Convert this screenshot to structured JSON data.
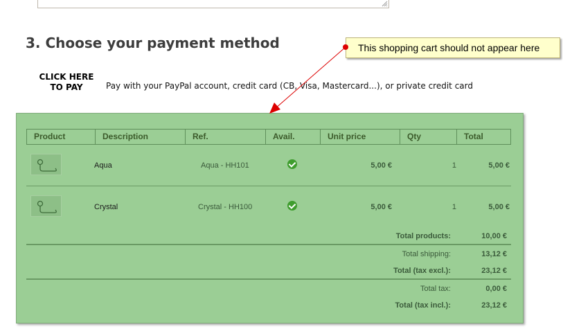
{
  "heading": "3. Choose your payment method",
  "payment": {
    "click_label": "CLICK HERE TO PAY",
    "description": "Pay with your PayPal account, credit card (CB, Visa, Mastercard...), or private credit card"
  },
  "annotation": {
    "text": "This shopping cart should not appear here",
    "color": "#dd0000"
  },
  "cart": {
    "columns": [
      "Product",
      "Description",
      "Ref.",
      "Avail.",
      "Unit price",
      "Qty",
      "Total"
    ],
    "rows": [
      {
        "description": "Aqua",
        "ref": "Aqua - HH101",
        "avail_icon": "check-circle-icon",
        "unit_price": "5,00 €",
        "qty": "1",
        "total": "5,00 €"
      },
      {
        "description": "Crystal",
        "ref": "Crystal - HH100",
        "avail_icon": "check-circle-icon",
        "unit_price": "5,00 €",
        "qty": "1",
        "total": "5,00 €"
      }
    ],
    "totals": {
      "products_label": "Total products:",
      "products_value": "10,00 €",
      "shipping_label": "Total shipping:",
      "shipping_value": "13,12 €",
      "tax_excl_label": "Total (tax excl.):",
      "tax_excl_value": "23,12 €",
      "tax_label": "Total tax:",
      "tax_value": "0,00 €",
      "tax_incl_label": "Total (tax incl.):",
      "tax_incl_value": "23,12 €"
    },
    "background": "#9bce95"
  }
}
